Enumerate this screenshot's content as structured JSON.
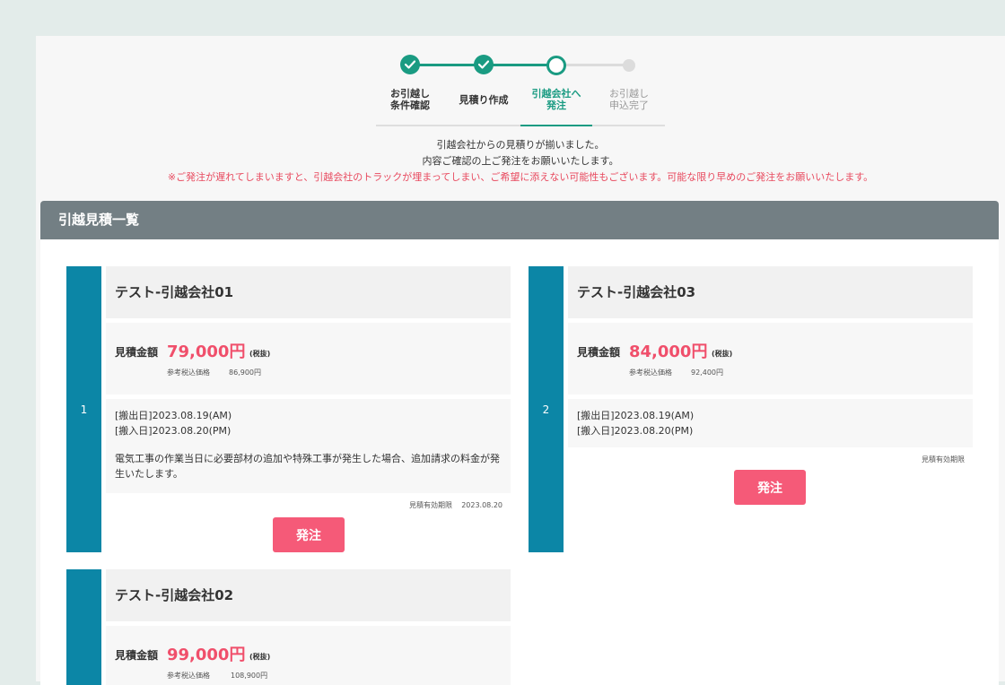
{
  "stepper": {
    "steps": [
      {
        "label_1": "お引越し",
        "label_2": "条件確認",
        "state": "done"
      },
      {
        "label_1": "見積り作成",
        "label_2": "",
        "state": "done"
      },
      {
        "label_1": "引越会社へ",
        "label_2": "発注",
        "state": "current"
      },
      {
        "label_1": "お引越し",
        "label_2": "申込完了",
        "state": "pending"
      }
    ]
  },
  "message": {
    "line_1": "引越会社からの見積りが揃いました。",
    "line_2": "内容ご確認の上ご発注をお願いいたします。",
    "warning": "※ご発注が遅れてしまいますと、引越会社のトラックが埋まってしまい、ご希望に添えない可能性もございます。可能な限り早めのご発注をお願いいたします。"
  },
  "panel": {
    "title": "引越見積一覧"
  },
  "quotes": [
    {
      "rank": "1",
      "company": "テスト-引越会社01",
      "price_label": "見積金額",
      "price": "79,000円",
      "tax_note": "(税抜)",
      "ref_label": "参考税込価格",
      "ref_price": "86,900円",
      "move_out": "[搬出日]2023.08.19(AM)",
      "move_in": "[搬入日]2023.08.20(PM)",
      "note": "電気工事の作業当日に必要部材の追加や特殊工事が発生した場合、追加請求の料金が発生いたします。",
      "validity_label": "見積有効期限",
      "validity_date": "2023.08.20",
      "button": "発注"
    },
    {
      "rank": "2",
      "company": "テスト-引越会社03",
      "price_label": "見積金額",
      "price": "84,000円",
      "tax_note": "(税抜)",
      "ref_label": "参考税込価格",
      "ref_price": "92,400円",
      "move_out": "[搬出日]2023.08.19(AM)",
      "move_in": "[搬入日]2023.08.20(PM)",
      "note": "",
      "validity_label": "見積有効期限",
      "validity_date": "",
      "button": "発注"
    },
    {
      "rank": "",
      "company": "テスト-引越会社02",
      "price_label": "見積金額",
      "price": "99,000円",
      "tax_note": "(税抜)",
      "ref_label": "参考税込価格",
      "ref_price": "108,900円"
    }
  ],
  "colors": {
    "accent_green": "#1a9b82",
    "rank_blue": "#0c86a6",
    "price_pink": "#f04f6b",
    "button_pink": "#f55a78",
    "header_gray": "#737f84"
  }
}
